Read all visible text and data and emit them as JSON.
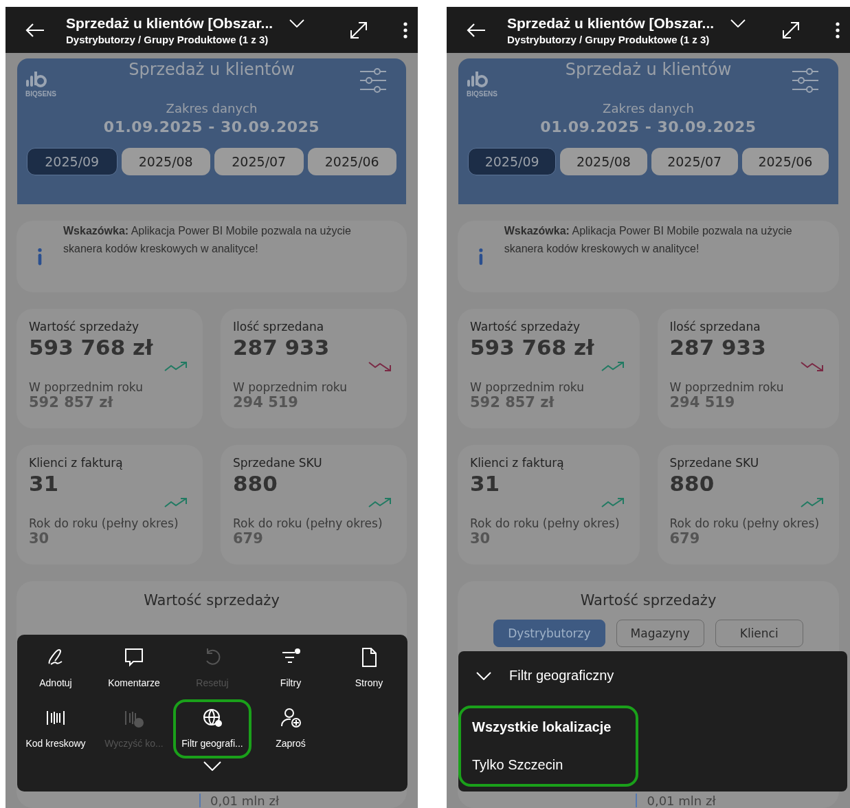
{
  "screens": [
    {
      "header": {
        "title": "Sprzedaż u klientów [Obszar...",
        "subtitle": "Dystrybutorzy / Grupy Produktowe (1 z 3)"
      },
      "banner": {
        "title": "Sprzedaż u klientów",
        "logo_text": "BIQSENS",
        "range_label": "Zakres danych",
        "range": "01.09.2025 - 30.09.2025",
        "periods": [
          {
            "label": "2025/09",
            "selected": true
          },
          {
            "label": "2025/08",
            "selected": false
          },
          {
            "label": "2025/07",
            "selected": false
          },
          {
            "label": "2025/06",
            "selected": false
          }
        ]
      },
      "tip": {
        "text": "**Wskazówka:**  Aplikacja Power BI Mobile pozwala na użycie skanera kodów kreskowych w analityce!"
      },
      "kpis": [
        {
          "label": "Wartość sprzedaży",
          "value": "593 768 zł",
          "trending_up": true,
          "compare_label": "W poprzednim roku",
          "compare_value": "592 857 zł"
        },
        {
          "label": "Ilość sprzedana",
          "value": "287 933",
          "trending_up": false,
          "compare_label": "W poprzednim roku",
          "compare_value": "294 519"
        },
        {
          "label": "Klienci z fakturą",
          "value": "31",
          "trending_up": true,
          "compare_label": "Rok do roku (pełny okres)",
          "compare_value": "30"
        },
        {
          "label": "Sprzedane SKU",
          "value": "880",
          "trending_up": true,
          "compare_label": "Rok do roku (pełny okres)",
          "compare_value": "679"
        }
      ],
      "chart_card": {
        "title": "Wartość sprzedaży",
        "footer_value": "0,01 mln zł"
      },
      "overlay": {
        "kind": "action_menu",
        "actions": [
          {
            "label": "Adnotuj",
            "disabled": false,
            "highlighted": false
          },
          {
            "label": "Komentarze",
            "disabled": false,
            "highlighted": false
          },
          {
            "label": "Resetuj",
            "disabled": true,
            "highlighted": false
          },
          {
            "label": "Filtry",
            "disabled": false,
            "highlighted": false
          },
          {
            "label": "Strony",
            "disabled": false,
            "highlighted": false
          },
          {
            "label": "Kod kreskowy",
            "disabled": false,
            "highlighted": false
          },
          {
            "label": "Wyczyść ko...",
            "disabled": true,
            "highlighted": false
          },
          {
            "label": "Filtr geografi...",
            "disabled": false,
            "highlighted": true
          },
          {
            "label": "Zaproś",
            "disabled": false,
            "highlighted": false
          }
        ]
      }
    },
    {
      "header": {
        "title": "Sprzedaż u klientów [Obszar...",
        "subtitle": "Dystrybutorzy / Grupy Produktowe (1 z 3)"
      },
      "banner": {
        "title": "Sprzedaż u klientów",
        "logo_text": "BIQSENS",
        "range_label": "Zakres danych",
        "range": "01.09.2025 - 30.09.2025",
        "periods": [
          {
            "label": "2025/09",
            "selected": true
          },
          {
            "label": "2025/08",
            "selected": false
          },
          {
            "label": "2025/07",
            "selected": false
          },
          {
            "label": "2025/06",
            "selected": false
          }
        ]
      },
      "tip": {
        "text": "**Wskazówka:**  Aplikacja Power BI Mobile pozwala na użycie skanera kodów kreskowych w analityce!"
      },
      "kpis": [
        {
          "label": "Wartość sprzedaży",
          "value": "593 768 zł",
          "trending_up": true,
          "compare_label": "W poprzednim roku",
          "compare_value": "592 857 zł"
        },
        {
          "label": "Ilość sprzedana",
          "value": "287 933",
          "trending_up": false,
          "compare_label": "W poprzednim roku",
          "compare_value": "294 519"
        },
        {
          "label": "Klienci z fakturą",
          "value": "31",
          "trending_up": true,
          "compare_label": "Rok do roku (pełny okres)",
          "compare_value": "30"
        },
        {
          "label": "Sprzedane SKU",
          "value": "880",
          "trending_up": true,
          "compare_label": "Rok do roku (pełny okres)",
          "compare_value": "679"
        }
      ],
      "chart_card": {
        "title": "Wartość sprzedaży",
        "tabs": [
          {
            "label": "Dystrybutorzy",
            "selected": true
          },
          {
            "label": "Magazyny",
            "selected": false
          },
          {
            "label": "Klienci",
            "selected": false
          }
        ],
        "footer_value": "0,01 mln zł"
      },
      "overlay": {
        "kind": "filter_sheet",
        "title": "Filtr geograficzny",
        "highlighted": true,
        "options": [
          {
            "label": "Wszystkie lokalizacje",
            "selected": true
          },
          {
            "label": "Tylko Szczecin",
            "selected": false
          }
        ]
      }
    }
  ]
}
